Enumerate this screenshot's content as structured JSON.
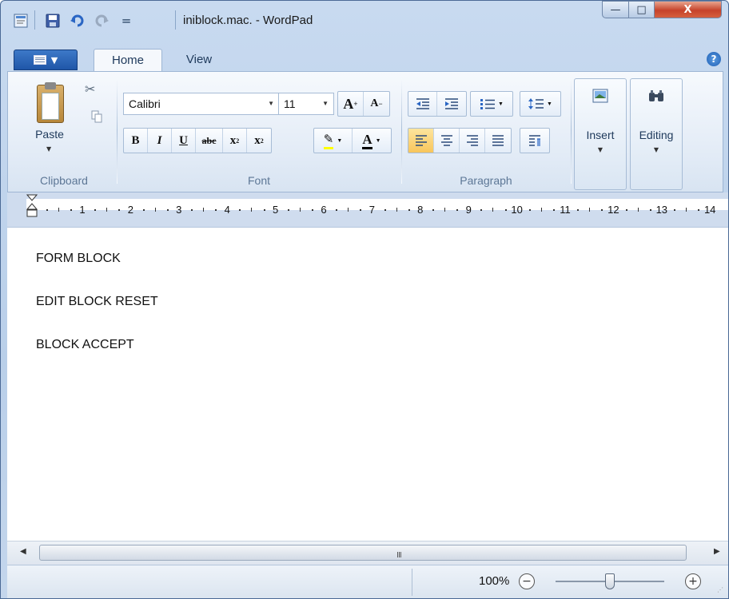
{
  "window": {
    "title": "iniblock.mac. - WordPad",
    "controls": {
      "minimize": "—",
      "maximize": "□",
      "close": "X"
    }
  },
  "quick_access": {
    "dropdown": "="
  },
  "tabs": [
    {
      "label": "Home",
      "active": true
    },
    {
      "label": "View",
      "active": false
    }
  ],
  "help": "?",
  "ribbon": {
    "clipboard": {
      "label": "Clipboard",
      "paste_label": "Paste"
    },
    "font": {
      "label": "Font",
      "font_name": "Calibri",
      "font_size": "11",
      "grow": "A",
      "shrink": "A",
      "bold": "B",
      "italic": "I",
      "underline": "U",
      "strikethrough": "abc",
      "subscript": "x",
      "superscript": "x",
      "highlight": "✎",
      "font_color": "A"
    },
    "paragraph": {
      "label": "Paragraph"
    },
    "insert": {
      "label": "Insert"
    },
    "editing": {
      "label": "Editing"
    }
  },
  "ruler": {
    "marks": [
      "1",
      "2",
      "3",
      "4",
      "5",
      "6",
      "7",
      "8",
      "9",
      "10",
      "11",
      "12",
      "13",
      "14"
    ]
  },
  "document": {
    "lines": [
      "FORM BLOCK",
      "EDIT BLOCK RESET",
      "BLOCK ACCEPT"
    ]
  },
  "scrollbar": {
    "grip": "III"
  },
  "status": {
    "zoom": "100%",
    "zoom_out": "−",
    "zoom_in": "+",
    "zoom_level": 0.5
  },
  "colors": {
    "accent": "#1f56a8",
    "active_button": "#f8c55b",
    "close_button": "#c6432b"
  }
}
